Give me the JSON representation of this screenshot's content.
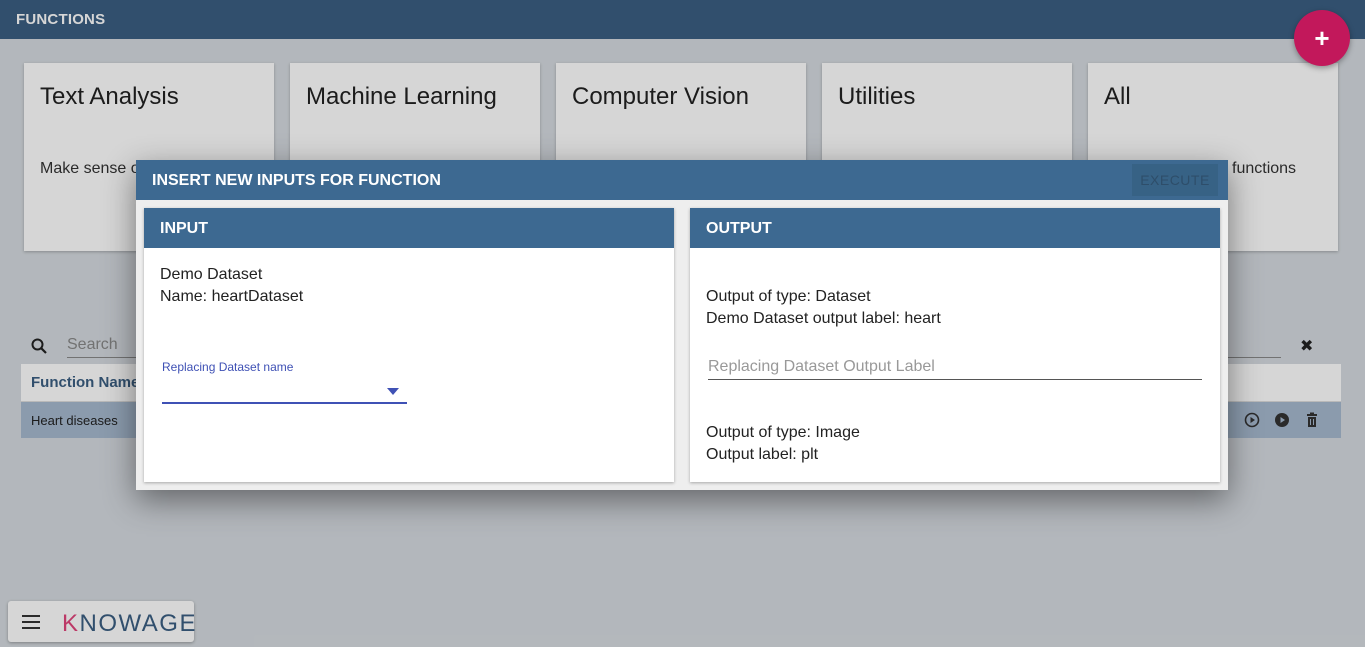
{
  "topbar": {
    "title": "FUNCTIONS",
    "add_label": "+"
  },
  "cards": [
    {
      "title": "Text Analysis",
      "description": "Make sense of text"
    },
    {
      "title": "Machine Learning",
      "description": ""
    },
    {
      "title": "Computer Vision",
      "description": ""
    },
    {
      "title": "Utilities",
      "description": ""
    },
    {
      "title": "All",
      "description": "functions"
    }
  ],
  "search": {
    "placeholder": "Search"
  },
  "table": {
    "columns": [
      "Function Name"
    ],
    "rows": [
      {
        "name": "Heart diseases"
      }
    ]
  },
  "bottom_bar": {
    "logo_k": "K",
    "logo_rest": "NOWAGE"
  },
  "dialog": {
    "title": "INSERT NEW INPUTS FOR FUNCTION",
    "execute_label": "EXECUTE",
    "input_panel": {
      "title": "INPUT",
      "dataset_line": "Demo Dataset",
      "name_line": "Name: heartDataset",
      "select_label": "Replacing Dataset name",
      "select_value": ""
    },
    "output_panel": {
      "title": "OUTPUT",
      "out1_type": "Output of type: Dataset",
      "out1_label": "Demo Dataset output label: heart",
      "out1_placeholder": "Replacing Dataset Output Label",
      "out2_type": "Output of type: Image",
      "out2_label": "Output label: plt"
    }
  },
  "colors": {
    "primary": "#3b5f82",
    "accent": "#c2185b",
    "row_selected": "#a6b9cf",
    "select_underline": "#3f51b5"
  }
}
